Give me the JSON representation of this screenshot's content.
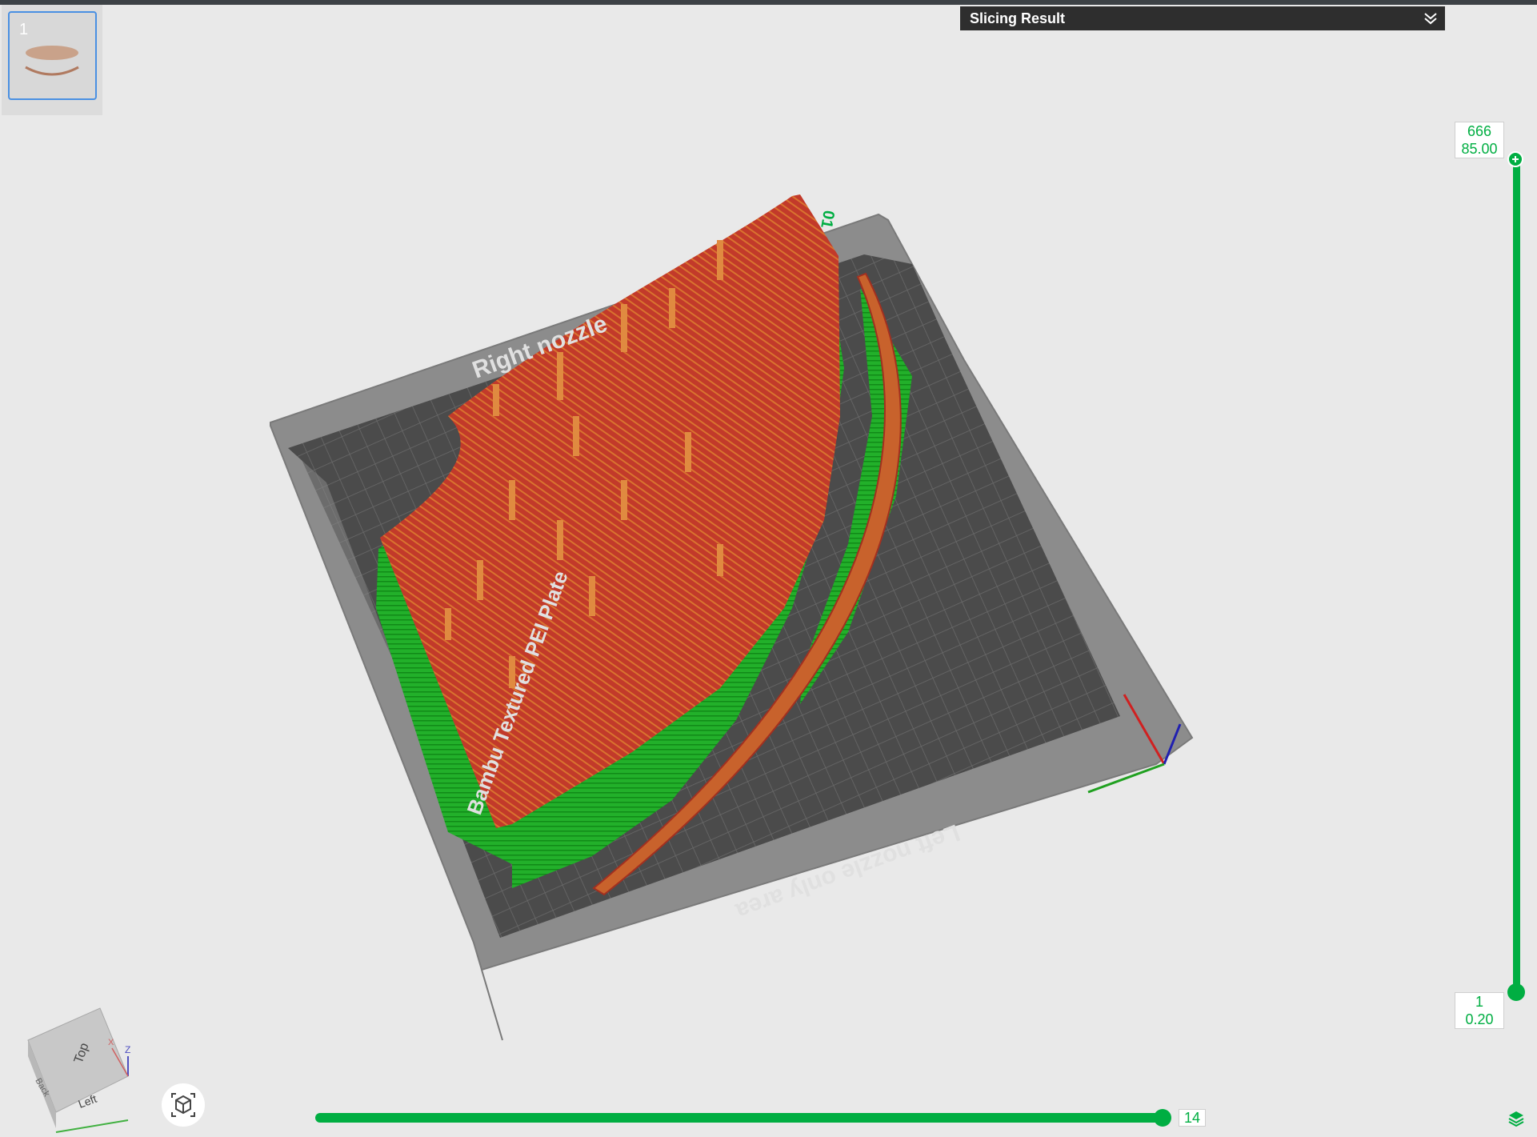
{
  "plate": {
    "index": "1"
  },
  "header": {
    "title": "Slicing Result",
    "collapse_icon": "double-chevron-down-icon"
  },
  "bed": {
    "plate_name": "Bambu Textured PEI Plate",
    "right_label": "Right nozzle",
    "left_label": "Left nozzle only area",
    "corner_mark": "01"
  },
  "layer_slider": {
    "top_layer": "666",
    "top_height": "85.00",
    "bottom_layer": "1",
    "bottom_height": "0.20"
  },
  "move_slider": {
    "value": "14"
  },
  "view_cube": {
    "top": "Top",
    "left": "Left",
    "back": "Back",
    "axis_z": "Z",
    "axis_x": "X"
  },
  "colors": {
    "accent": "#00ae42",
    "model": "#c23a2a",
    "support": "#22a82a",
    "bed_frame": "#8a8a8a",
    "bed_surface": "#4a4a4a"
  },
  "icons": [
    "double-chevron-down-icon",
    "view-cube-icon",
    "reset-view-icon",
    "layers-icon",
    "plus-icon"
  ]
}
